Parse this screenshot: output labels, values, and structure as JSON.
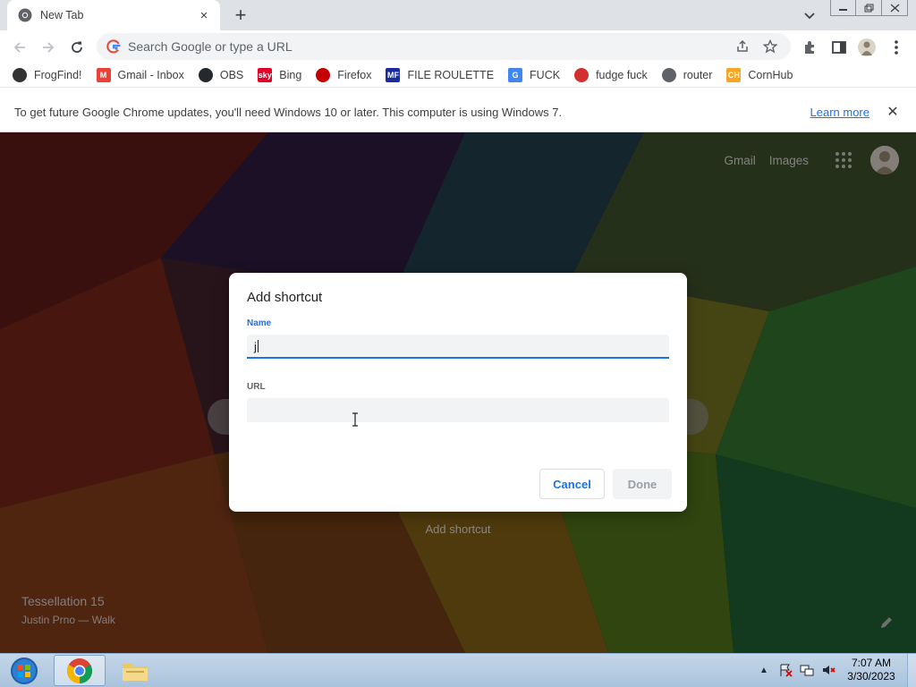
{
  "tab": {
    "title": "New Tab",
    "favicon": "chrome-icon",
    "close": "×"
  },
  "toolbar": {
    "omnibox_placeholder": "Search Google or type a URL",
    "icons": [
      "back-icon",
      "forward-icon",
      "reload-icon",
      "share-icon",
      "star-icon",
      "puzzle-icon",
      "sidepanel-icon",
      "profile-icon",
      "menu-icon"
    ]
  },
  "bookmarks": [
    {
      "label": "FrogFind!",
      "icon": "frog-icon",
      "color": "#333333",
      "glyph": ""
    },
    {
      "label": "Gmail - Inbox",
      "icon": "gmail-icon",
      "color": "#ea4335",
      "glyph": "M"
    },
    {
      "label": "OBS",
      "icon": "github-icon",
      "color": "#24292e",
      "glyph": ""
    },
    {
      "label": "Bing",
      "icon": "sky-icon",
      "color": "#e4002b",
      "glyph": "sky"
    },
    {
      "label": "Firefox",
      "icon": "firefox-icon",
      "color": "#c40000",
      "glyph": ""
    },
    {
      "label": "FILE ROULETTE",
      "icon": "file-roulette-icon",
      "color": "#1b2a9c",
      "glyph": "MF"
    },
    {
      "label": "FUCK",
      "icon": "google-icon",
      "color": "#4285f4",
      "glyph": "G"
    },
    {
      "label": "fudge fuck",
      "icon": "flag-icon",
      "color": "#d32f2f",
      "glyph": ""
    },
    {
      "label": "router",
      "icon": "globe-icon",
      "color": "#5f6368",
      "glyph": ""
    },
    {
      "label": "CornHub",
      "icon": "cornhub-icon",
      "color": "#f5a623",
      "glyph": "CH"
    }
  ],
  "infobar": {
    "message": "To get future Google Chrome updates, you'll need Windows 10 or later. This computer is using Windows 7.",
    "link": "Learn more",
    "close": "✕"
  },
  "ntp": {
    "gmail": "Gmail",
    "images": "Images",
    "add_shortcut": "Add shortcut",
    "attribution_title": "Tessellation 15",
    "attribution_author": "Justin Prno — Walk"
  },
  "dialog": {
    "title": "Add shortcut",
    "name_label": "Name",
    "name_value": "j",
    "url_label": "URL",
    "url_value": "",
    "cancel": "Cancel",
    "done": "Done"
  },
  "taskbar": {
    "time": "7:07 AM",
    "date": "3/30/2023",
    "apps": [
      "start-orb-icon",
      "chrome-icon",
      "explorer-folder-icon"
    ],
    "tray": [
      "tray-arrow-icon",
      "action-center-flag-icon",
      "network-icon",
      "volume-muted-icon"
    ]
  },
  "colors": {
    "accent": "#1a73e8",
    "tabstrip": "#dee1e6",
    "omnibox": "#f1f3f4"
  }
}
